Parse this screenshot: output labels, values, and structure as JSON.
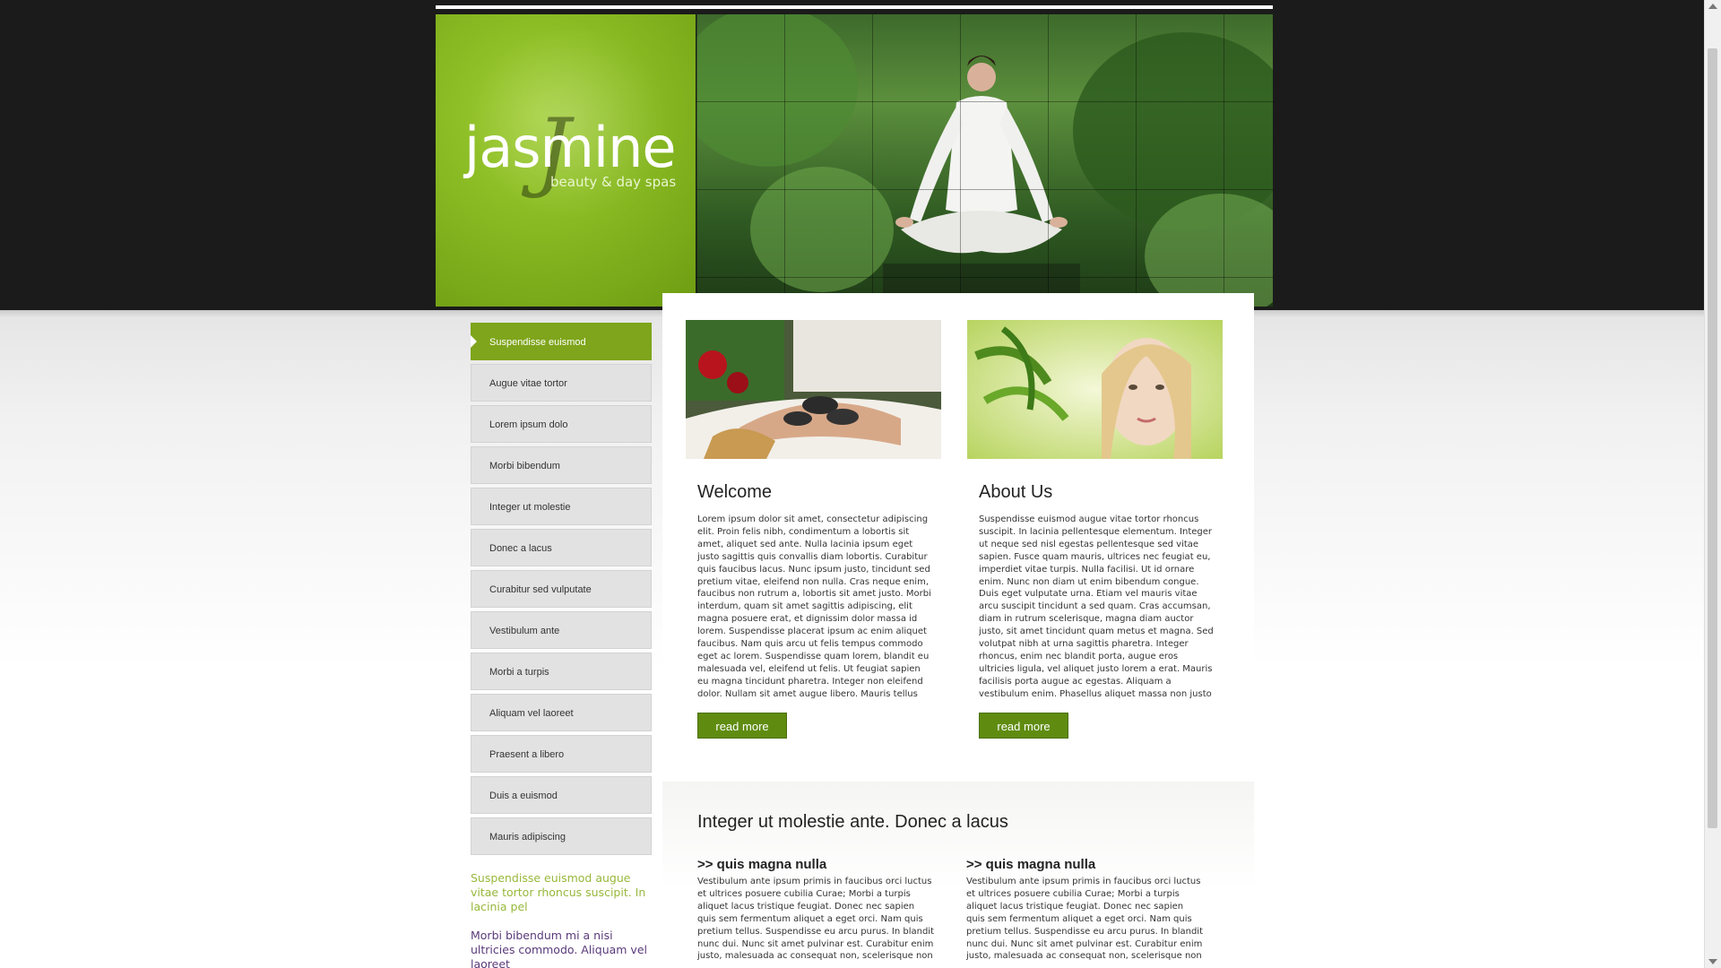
{
  "logo": {
    "word": "jasmine",
    "subtitle": "beauty & day spas"
  },
  "sidebar": {
    "items": [
      {
        "label": "Suspendisse euismod"
      },
      {
        "label": "Augue vitae tortor"
      },
      {
        "label": "Lorem ipsum dolo"
      },
      {
        "label": "Morbi bibendum"
      },
      {
        "label": "Integer ut molestie"
      },
      {
        "label": "Donec a lacus"
      },
      {
        "label": "Curabitur sed vulputate"
      },
      {
        "label": "Vestibulum ante"
      },
      {
        "label": "Morbi a turpis"
      },
      {
        "label": "Aliquam vel laoreet"
      },
      {
        "label": "Praesent a libero"
      },
      {
        "label": "Duis a euismod"
      },
      {
        "label": "Mauris adipiscing"
      }
    ],
    "active_index": 0,
    "text_green": "Suspendisse euismod augue vitae tortor rhoncus suscipit. In lacinia pel",
    "text_purple": "Morbi bibendum mi a nisi ultricies commodo. Aliquam vel laoreet"
  },
  "welcome": {
    "title": "Welcome",
    "body": "Lorem ipsum dolor sit amet, consectetur adipiscing elit. Proin felis nibh, condimentum a lobortis sit amet, aliquet sed ante. Nulla lacinia ipsum eget justo sagittis quis convallis diam lobortis. Curabitur quis faucibus lacus. Nunc ipsum justo, tincidunt sed pretium vitae, eleifend non nulla. Cras neque enim, faucibus non rutrum a, lobortis sit amet justo. Morbi interdum, quam sit amet sagittis adipiscing, elit magna posuere erat, et dignissim dolor massa id lorem. Suspendisse placerat ipsum ac enim aliquet faucibus. Nam quis arcu ut felis tempus commodo eget ac lorem. Suspendisse quam lorem, blandit eu malesuada vel, eleifend ut felis. Ut feugiat sapien eu magna tincidunt pharetra. Integer non eleifend dolor. Nullam sit amet augue libero. Mauris tellus velit,",
    "button": "read more"
  },
  "about": {
    "title": "About Us",
    "body": "Suspendisse euismod augue vitae tortor rhoncus suscipit. In lacinia pellentesque elementum. Integer ut neque sed nisl egestas pellentesque sed vitae sapien. Fusce quam mauris, ultrices nec feugiat eu, imperdiet vitae turpis. Nulla facilisi. Ut id ornare enim. Nunc non diam ut enim bibendum congue. Duis eget vulputate urna. Etiam vel mauris vitae arcu suscipit tincidunt a sed quam. Cras accumsan, diam in rutrum scelerisque, magna diam auctor justo, sit amet tincidunt quam metus et magna. Sed volutpat nibh at urna sagittis pharetra. Integer rhoncus, enim nec blandit porta, augue eros ultricies ligula, vel aliquet justo lorem a erat. Mauris facilisis porta augue ac egestas. Aliquam a vestibulum enim. Phasellus aliquet massa non justo faucibus et volutpat nulla",
    "button": "read more"
  },
  "lower": {
    "title": "Integer ut molestie ante. Donec a lacus",
    "col1": {
      "title": ">> quis magna nulla",
      "body": "Vestibulum ante ipsum primis in faucibus orci luctus et ultrices posuere cubilia Curae; Morbi a turpis aliquet lacus tristique feugiat. Donec nec sapien quis sem fermentum aliquet a eget orci. Nam quis pretium tellus. Suspendisse eu arcu purus. In blandit nunc dui. Nunc sit amet pulvinar est. Curabitur enim justo, malesuada ac consequat non, scelerisque non"
    },
    "col2": {
      "title": ">> quis magna nulla",
      "body": "Vestibulum ante ipsum primis in faucibus orci luctus et ultrices posuere cubilia Curae; Morbi a turpis aliquet lacus tristique feugiat. Donec nec sapien quis sem fermentum aliquet a eget orci. Nam quis pretium tellus. Suspendisse eu arcu purus. In blandit nunc dui. Nunc sit amet pulvinar est. Curabitur enim justo, malesuada ac consequat non, scelerisque non"
    }
  },
  "colors": {
    "accent": "#7ea51b",
    "button": "#5f8c10",
    "dark_band": "#1b1b1b"
  },
  "icons": {
    "logo": "jasmine-flower-logo"
  }
}
